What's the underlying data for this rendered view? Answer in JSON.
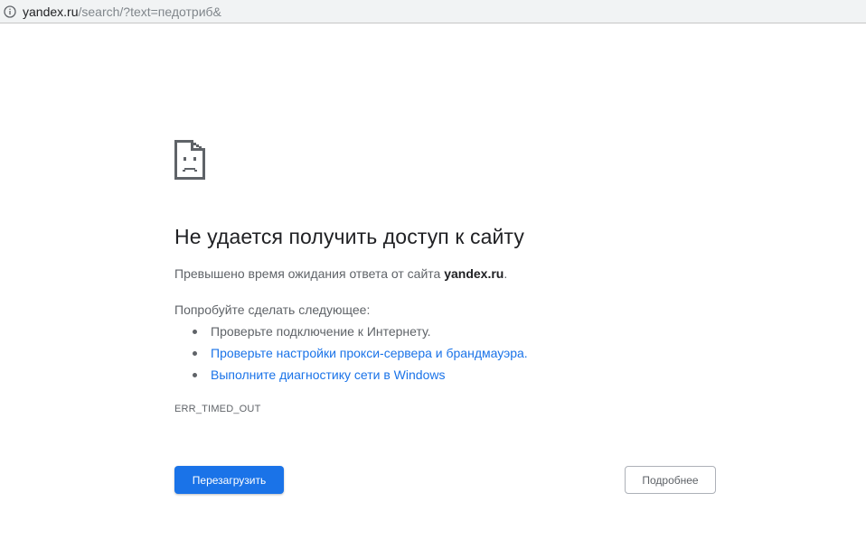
{
  "address_bar": {
    "icon": "info-icon",
    "host": "yandex.ru",
    "path": "/search/?text=педотриб&"
  },
  "error_page": {
    "icon": "sad-page-icon",
    "title": "Не удается получить доступ к сайту",
    "description_prefix": "Превышено время ожидания ответа от сайта ",
    "description_site": "yandex.ru",
    "description_suffix": ".",
    "try_heading": "Попробуйте сделать следующее:",
    "suggestions": [
      "Проверьте подключение к Интернету.",
      "Проверьте настройки прокси-сервера и брандмауэра.",
      "Выполните диагностику сети в Windows"
    ],
    "error_code": "ERR_TIMED_OUT",
    "reload_button": "Перезагрузить",
    "details_button": "Подробнее"
  },
  "colors": {
    "accent": "#1a73e8",
    "text": "#202124",
    "secondary_text": "#5f6368"
  }
}
